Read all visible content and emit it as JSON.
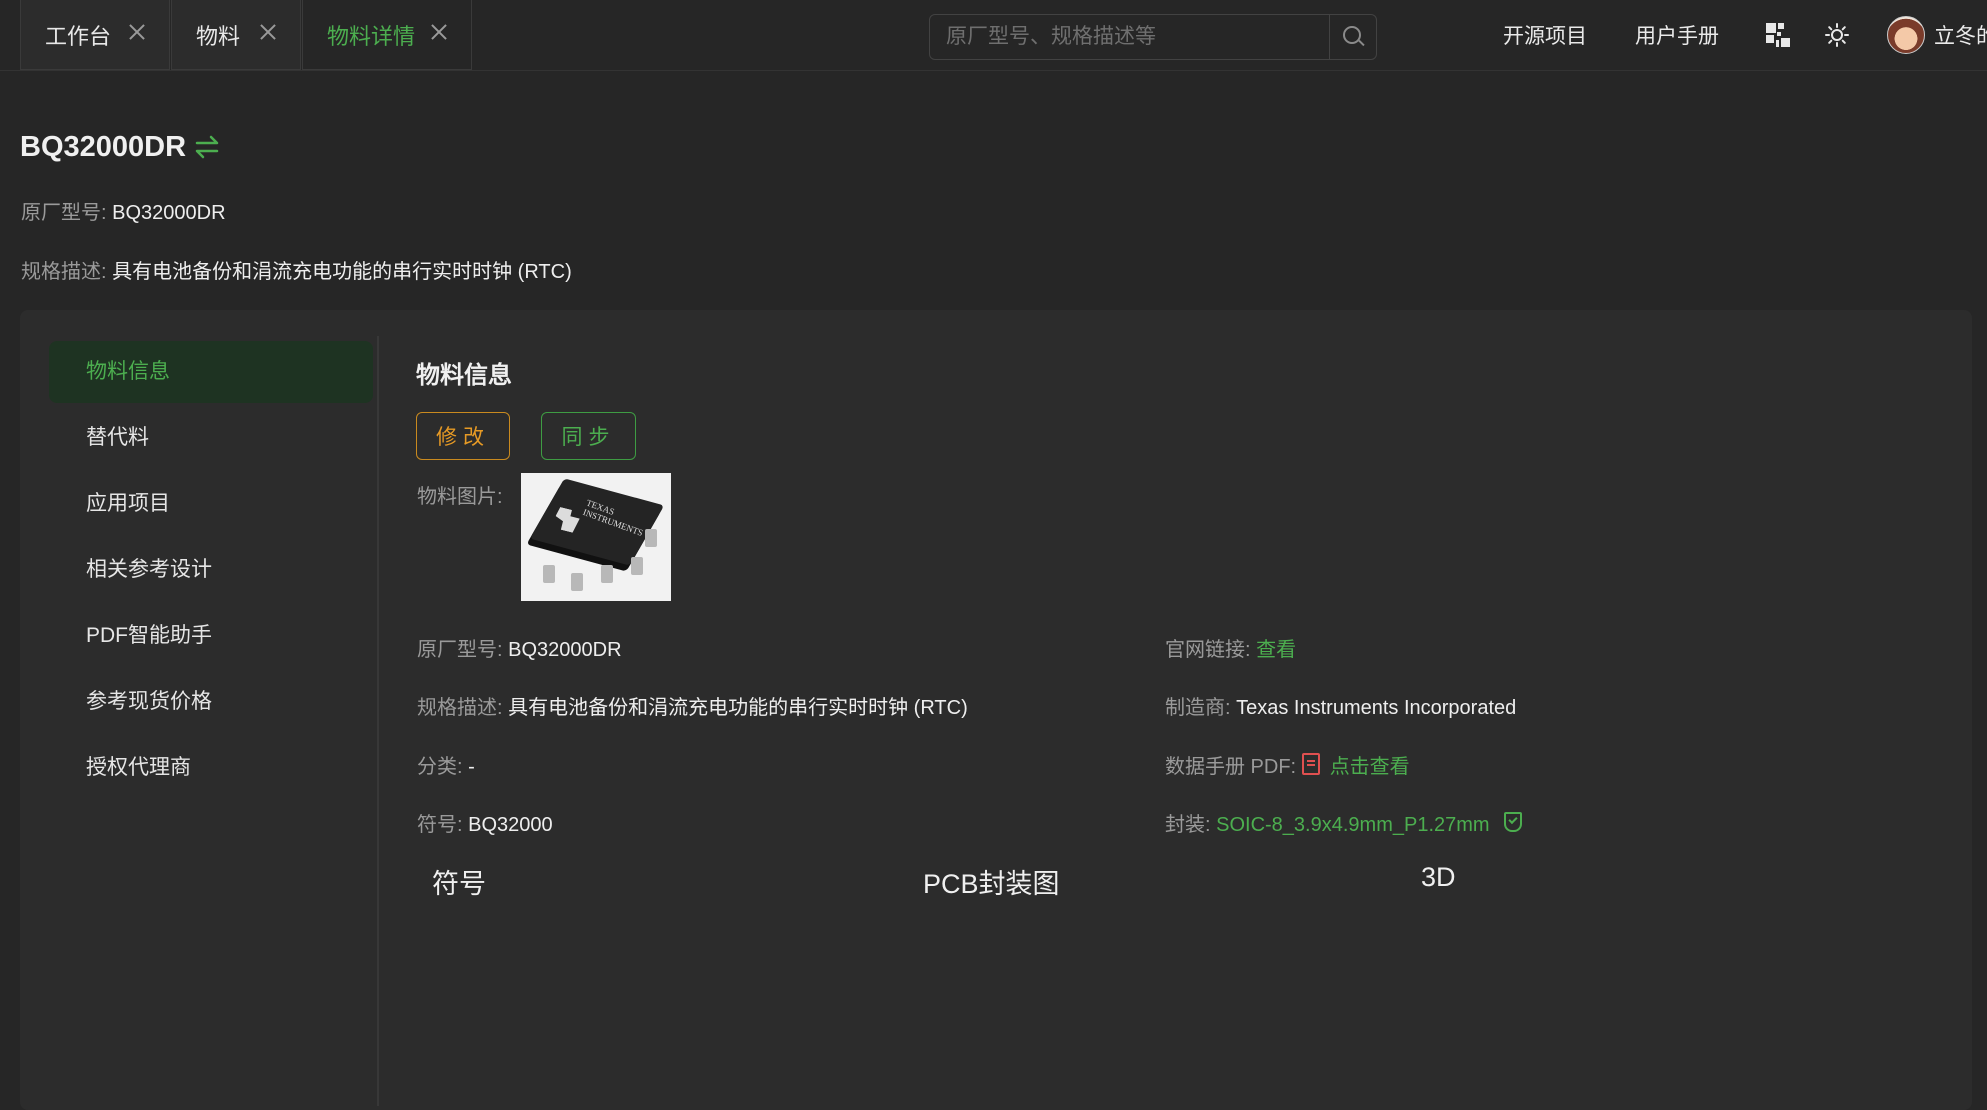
{
  "tabs": [
    {
      "label": "工作台"
    },
    {
      "label": "物料"
    },
    {
      "label": "物料详情"
    }
  ],
  "search": {
    "placeholder": "原厂型号、规格描述等"
  },
  "nav": {
    "open_source": "开源项目",
    "manual": "用户手册",
    "username": "立冬的"
  },
  "header": {
    "title": "BQ32000DR",
    "mfr_part_label": "原厂型号:",
    "mfr_part_value": "BQ32000DR",
    "spec_label": "规格描述:",
    "spec_value": "具有电池备份和涓流充电功能的串行实时时钟 (RTC)"
  },
  "sidebar": {
    "items": [
      {
        "label": "物料信息"
      },
      {
        "label": "替代料"
      },
      {
        "label": "应用项目"
      },
      {
        "label": "相关参考设计"
      },
      {
        "label": "PDF智能助手"
      },
      {
        "label": "参考现货价格"
      },
      {
        "label": "授权代理商"
      }
    ]
  },
  "detail": {
    "section_title": "物料信息",
    "edit_button": "修改",
    "sync_button": "同步",
    "image_label": "物料图片:",
    "chip_marking": "TEXAS INSTRUMENTS",
    "left": [
      {
        "label": "原厂型号:",
        "value": "BQ32000DR"
      },
      {
        "label": "规格描述:",
        "value": "具有电池备份和涓流充电功能的串行实时时钟 (RTC)"
      },
      {
        "label": "分类:",
        "value": "-"
      },
      {
        "label": "符号:",
        "value": "BQ32000"
      }
    ],
    "right": [
      {
        "label": "官网链接:",
        "value": "查看"
      },
      {
        "label": "制造商:",
        "value": "Texas Instruments Incorporated"
      },
      {
        "label": "数据手册 PDF:",
        "value": "点击查看"
      },
      {
        "label": "封装:",
        "value": "SOIC-8_3.9x4.9mm_P1.27mm"
      }
    ],
    "views": [
      "符号",
      "PCB封装图",
      "3D"
    ]
  },
  "colors": {
    "accent": "#4cae4f",
    "warning": "#e69a25",
    "background": "#262626",
    "panel": "#2c2c2c",
    "pdf": "#e05050"
  }
}
